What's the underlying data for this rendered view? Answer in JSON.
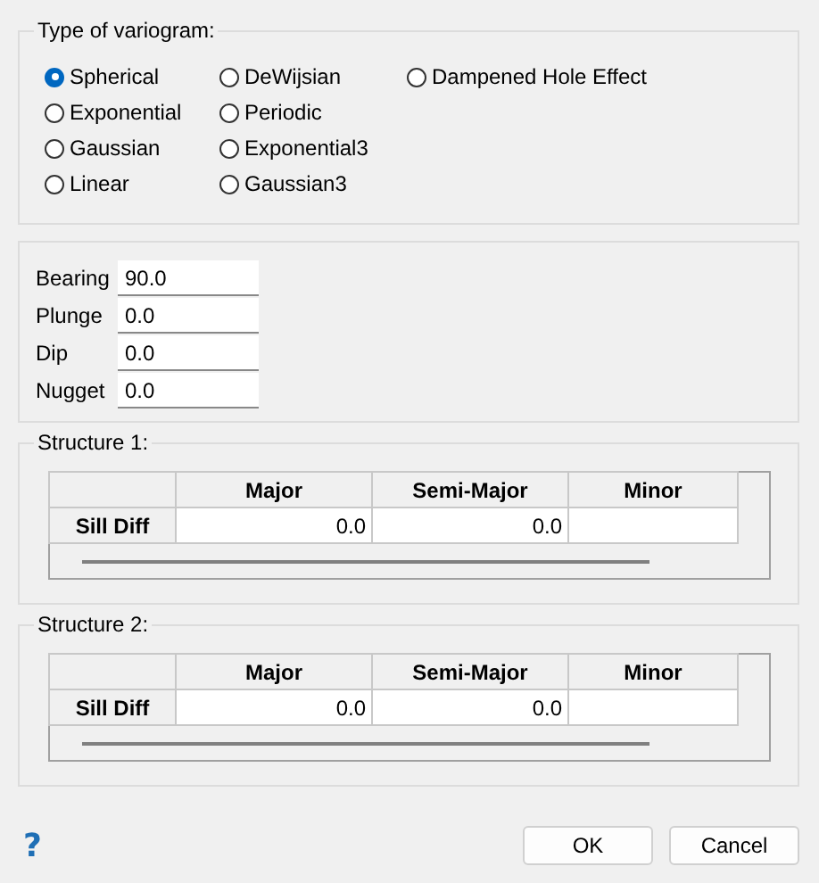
{
  "variogram": {
    "title": "Type of variogram:",
    "options": [
      {
        "label": "Spherical",
        "selected": true
      },
      {
        "label": "Exponential",
        "selected": false
      },
      {
        "label": "Gaussian",
        "selected": false
      },
      {
        "label": "Linear",
        "selected": false
      },
      {
        "label": "DeWijsian",
        "selected": false
      },
      {
        "label": "Periodic",
        "selected": false
      },
      {
        "label": "Exponential3",
        "selected": false
      },
      {
        "label": "Gaussian3",
        "selected": false
      },
      {
        "label": "Dampened Hole Effect",
        "selected": false
      }
    ]
  },
  "orientation": {
    "fields": [
      {
        "label": "Bearing",
        "value": "90.0"
      },
      {
        "label": "Plunge",
        "value": "0.0"
      },
      {
        "label": "Dip",
        "value": "0.0"
      },
      {
        "label": "Nugget",
        "value": "0.0"
      }
    ]
  },
  "structures": [
    {
      "title": "Structure 1:",
      "columns": [
        "Major",
        "Semi-Major",
        "Minor"
      ],
      "rows": [
        {
          "header": "Sill Diff",
          "cells": [
            "0.0",
            "0.0"
          ]
        }
      ]
    },
    {
      "title": "Structure 2:",
      "columns": [
        "Major",
        "Semi-Major",
        "Minor"
      ],
      "rows": [
        {
          "header": "Sill Diff",
          "cells": [
            "0.0",
            "0.0"
          ]
        }
      ]
    }
  ],
  "help": "?",
  "buttons": [
    "OK",
    "Cancel"
  ]
}
